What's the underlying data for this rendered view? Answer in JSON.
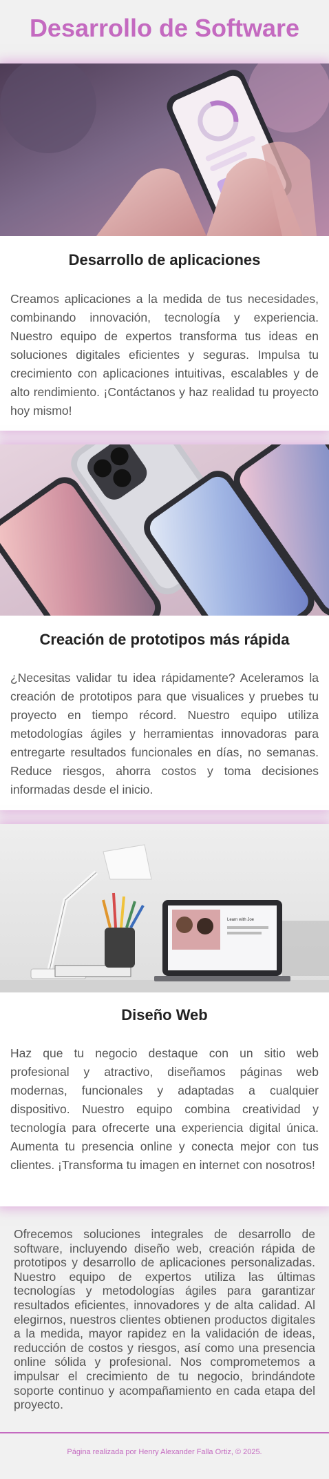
{
  "page": {
    "title": "Desarrollo de Software",
    "accent_color": "#c46ac0",
    "background_color": "#f1f1f1"
  },
  "cards": [
    {
      "image_icon": "phone-app-photo",
      "heading": "Desarrollo de aplicaciones",
      "text": "Creamos aplicaciones a la medida de tus necesidades, combinando innovación, tecnología y experiencia. Nuestro equipo de expertos transforma tus ideas en soluciones digitales eficientes y seguras. Impulsa tu crecimiento con aplicaciones intuitivas, escalables y de alto rendimiento. ¡Contáctanos y haz realidad tu proyecto hoy mismo!"
    },
    {
      "image_icon": "smartphones-photo",
      "heading": "Creación de prototipos más rápida",
      "text": "¿Necesitas validar tu idea rápidamente? Aceleramos la creación de prototipos para que visualices y pruebes tu proyecto en tiempo récord. Nuestro equipo utiliza metodologías ágiles y herramientas innovadoras para entregarte resultados funcionales en días, no semanas. Reduce riesgos, ahorra costos y toma decisiones informadas desde el inicio."
    },
    {
      "image_icon": "desk-laptop-photo",
      "heading": "Diseño Web",
      "text": "Haz que tu negocio destaque con un sitio web profesional y atractivo, diseñamos páginas web modernas, funcionales y adaptadas a cualquier dispositivo. Nuestro equipo combina creatividad y tecnología para ofrecerte una experiencia digital única. Aumenta tu presencia online y conecta mejor con tus clientes. ¡Transforma tu imagen en internet con nosotros!",
      "laptop_screen_text": "Learn with Joe"
    }
  ],
  "summary": "Ofrecemos soluciones integrales de desarrollo de software, incluyendo diseño web, creación rápida de prototipos y desarrollo de aplicaciones personalizadas. Nuestro equipo de expertos utiliza las últimas tecnologías y metodologías ágiles para garantizar resultados eficientes, innovadores y de alta calidad. Al elegirnos, nuestros clientes obtienen productos digitales a la medida, mayor rapidez en la validación de ideas, reducción de costos y riesgos, así como una presencia online sólida y profesional. Nos comprometemos a impulsar el crecimiento de tu negocio, brindándote soporte continuo y acompañamiento en cada etapa del proyecto.",
  "footer": {
    "text": "Página realizada por Henry Alexander Falla Ortiz, © 2025."
  }
}
